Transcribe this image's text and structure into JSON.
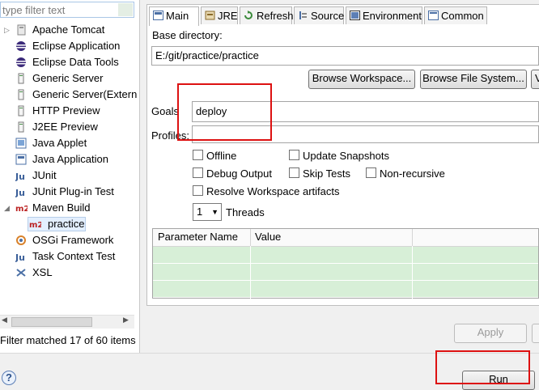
{
  "filter": {
    "placeholder": "type filter text"
  },
  "tree": {
    "items": [
      {
        "label": "Apache Tomcat",
        "icon": "tomcat-icon",
        "expandable": true
      },
      {
        "label": "Eclipse Application",
        "icon": "eclipse-icon"
      },
      {
        "label": "Eclipse Data Tools",
        "icon": "data-tools-icon"
      },
      {
        "label": "Generic Server",
        "icon": "server-icon"
      },
      {
        "label": "Generic Server(Extern",
        "icon": "server-icon"
      },
      {
        "label": "HTTP Preview",
        "icon": "server-icon"
      },
      {
        "label": "J2EE Preview",
        "icon": "server-icon"
      },
      {
        "label": "Java Applet",
        "icon": "java-applet-icon"
      },
      {
        "label": "Java Application",
        "icon": "java-application-icon"
      },
      {
        "label": "JUnit",
        "icon": "junit-icon"
      },
      {
        "label": "JUnit Plug-in Test",
        "icon": "junit-icon"
      },
      {
        "label": "Maven Build",
        "icon": "maven-icon",
        "expanded": true
      },
      {
        "label": "practice",
        "icon": "maven-icon",
        "child": true,
        "selected": true
      },
      {
        "label": "OSGi Framework",
        "icon": "osgi-icon"
      },
      {
        "label": "Task Context Test",
        "icon": "junit-icon"
      },
      {
        "label": "XSL",
        "icon": "xsl-icon"
      }
    ],
    "status": "Filter matched 17 of 60 items"
  },
  "tabs": [
    {
      "label": "Main",
      "icon": "main-tab-icon",
      "active": true
    },
    {
      "label": "JRE",
      "icon": "jre-icon"
    },
    {
      "label": "Refresh",
      "icon": "refresh-icon"
    },
    {
      "label": "Source",
      "icon": "source-icon"
    },
    {
      "label": "Environment",
      "icon": "environment-icon"
    },
    {
      "label": "Common",
      "icon": "common-icon"
    }
  ],
  "main": {
    "base_dir_label": "Base directory:",
    "base_dir_value": "E:/git/practice/practice",
    "browse_workspace": "Browse Workspace...",
    "browse_fs": "Browse File System...",
    "third_button": "V",
    "goals_label": "Goals",
    "goals_value": "deploy",
    "profiles_label": "Profiles:",
    "profiles_value": "",
    "checkboxes": {
      "offline": "Offline",
      "update_snapshots": "Update Snapshots",
      "debug_output": "Debug Output",
      "skip_tests": "Skip Tests",
      "non_recursive": "Non-recursive",
      "resolve_workspace": "Resolve Workspace artifacts"
    },
    "threads_value": "1",
    "threads_label": "Threads",
    "params_table": {
      "columns": [
        "Parameter Name",
        "Value"
      ],
      "rows": 3
    }
  },
  "buttons": {
    "apply": "Apply",
    "run": "Run"
  },
  "colors": {
    "highlight": "#d11111",
    "table_row": "#d7efd7",
    "selection": "#e3efff"
  }
}
